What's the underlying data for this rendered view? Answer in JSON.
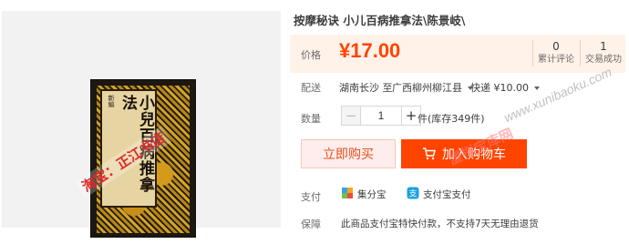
{
  "product": {
    "title": "按摩秘诀 小儿百病推拿法\\陈景岐\\"
  },
  "image": {
    "cover_small_text": "新編",
    "cover_title": "小兒百病推拿法",
    "stamp_text": "淘宝：正江书店"
  },
  "price": {
    "label": "价格",
    "value": "¥17.00",
    "reviews_count": "0",
    "reviews_label": "累计评论",
    "deals_count": "1",
    "deals_label": "交易成功"
  },
  "shipping": {
    "label": "配送",
    "from": "湖南长沙 至",
    "to": "广西柳州柳江县",
    "fee": "快递 ¥10.00"
  },
  "quantity": {
    "label": "数量",
    "minus": "−",
    "value": "1",
    "plus": "+",
    "stock": "件(库存349件)"
  },
  "actions": {
    "buy_now": "立即购买",
    "add_to_cart": "加入购物车"
  },
  "payment": {
    "label": "支付",
    "jifenbao": "集分宝",
    "alipay": "支付宝支付"
  },
  "guarantee": {
    "label": "保障",
    "text": "此商品支付宝特快付款，不支持7天无理由退货"
  },
  "watermark": {
    "text": "虚拟宝库网",
    "url": "www.xunibaoku.com"
  },
  "colors": {
    "accent": "#ff4400",
    "price": "#ff4400",
    "price_bg": "#fff2e8"
  }
}
